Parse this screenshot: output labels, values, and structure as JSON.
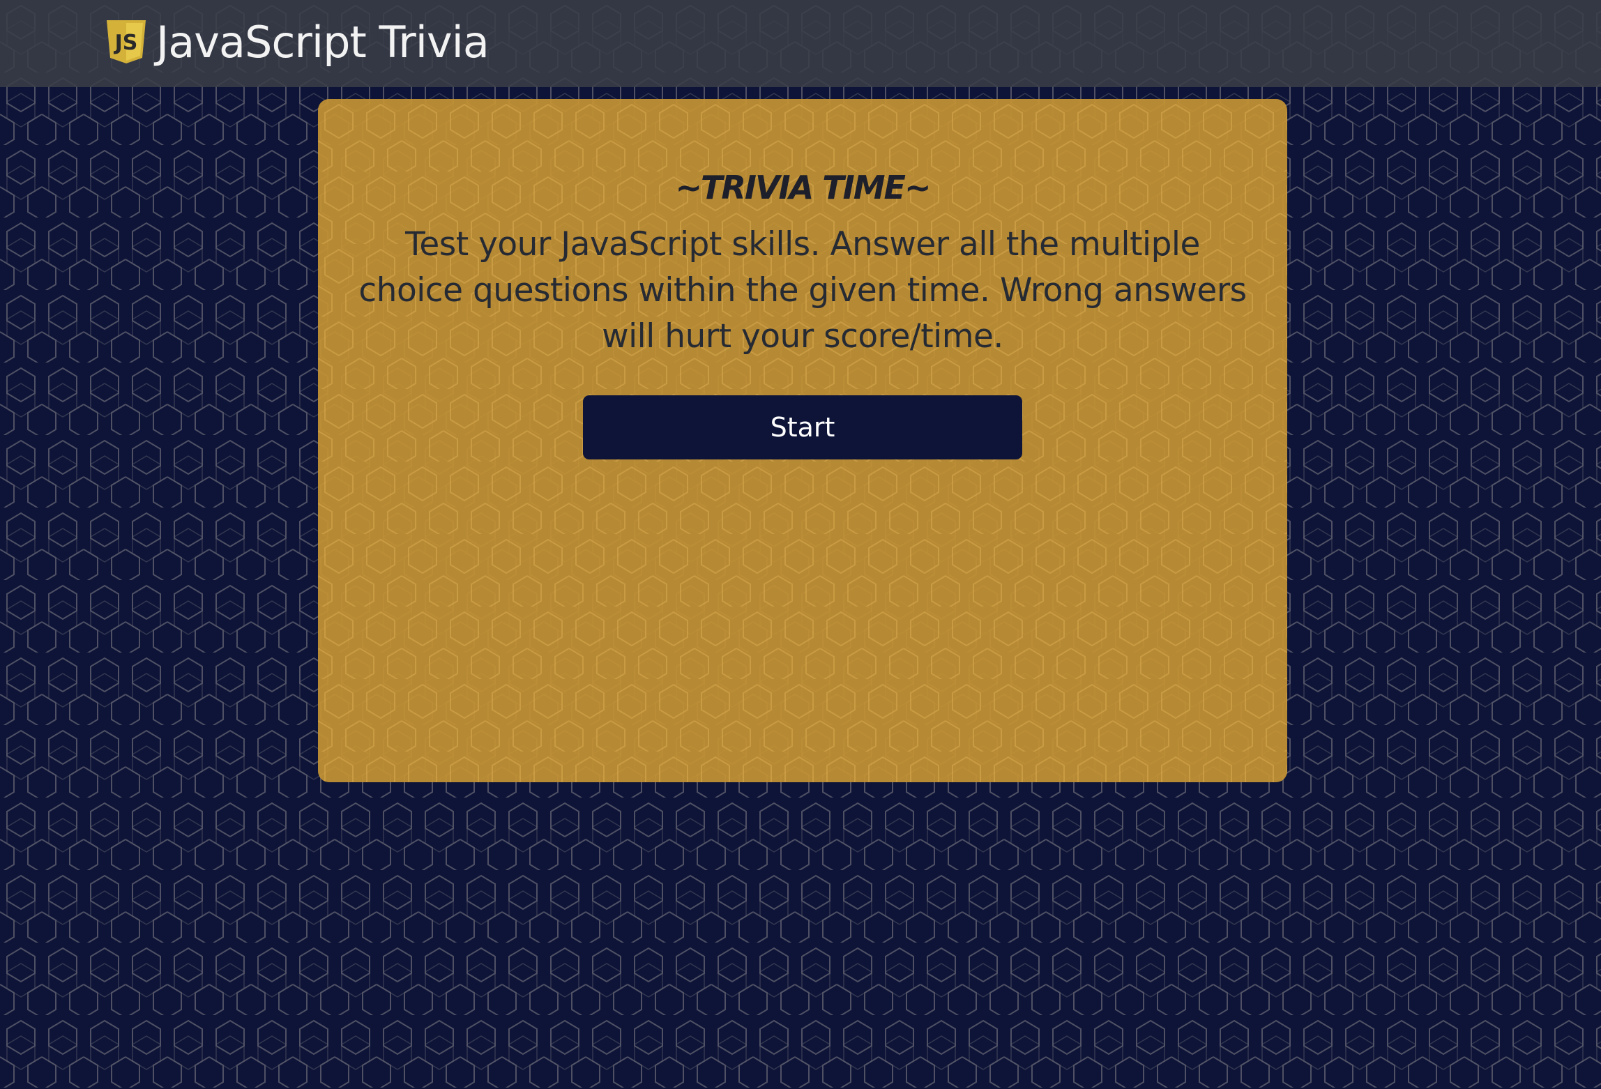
{
  "header": {
    "logo_text": "JS",
    "title": "JavaScript Trivia",
    "logo_icon": "js-shield-icon"
  },
  "card": {
    "title": "~TRIVIA TIME~",
    "description": "Test your JavaScript skills. Answer all the multiple choice questions within the given time. Wrong answers will hurt your score/time.",
    "start_label": "Start"
  },
  "colors": {
    "background": "#0d1437",
    "navbar": "#3a3e48",
    "card": "#c49234",
    "button": "#0d1437",
    "logo": "#d4b23a"
  }
}
